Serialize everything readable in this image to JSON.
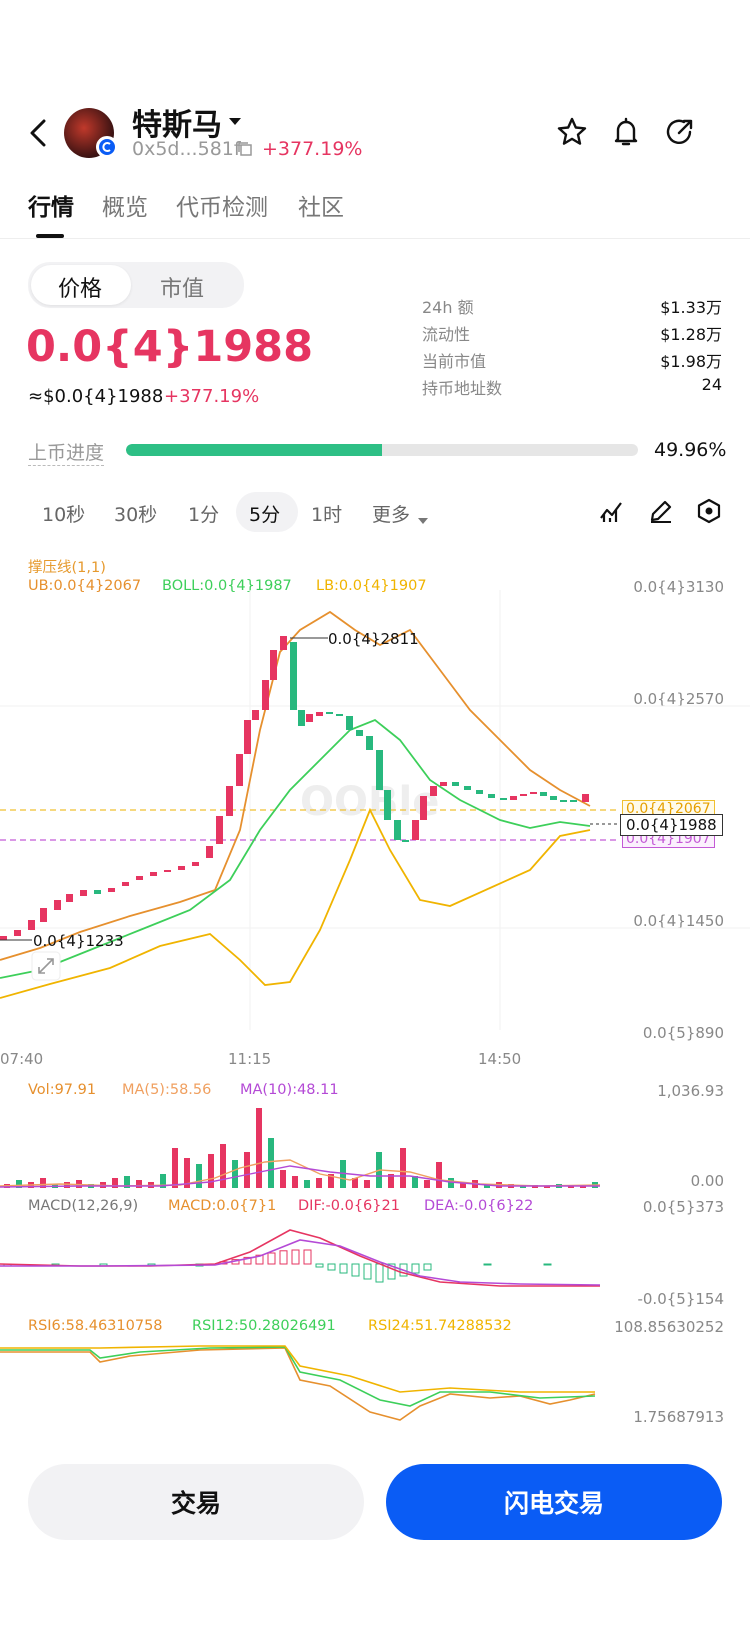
{
  "header": {
    "token_name": "特斯马",
    "address": "0x5d...581f",
    "change": "+377.19%"
  },
  "tabs": [
    "行情",
    "概览",
    "代币检测",
    "社区"
  ],
  "price_toggle": [
    "价格",
    "市值"
  ],
  "price": {
    "main": "0.0{4}1988",
    "usd": "≈$0.0{4}1988",
    "change": "+377.19%"
  },
  "stats": [
    {
      "label": "24h  额",
      "value": "$1.33万"
    },
    {
      "label": "流动性",
      "value": "$1.28万"
    },
    {
      "label": "当前市值",
      "value": "$1.98万"
    },
    {
      "label": "持币地址数",
      "value": "24"
    }
  ],
  "progress": {
    "label": "上币进度",
    "value_text": "49.96%",
    "fraction": 0.4996
  },
  "timeframes": [
    "10秒",
    "30秒",
    "1分",
    "5分",
    "1时",
    "更多"
  ],
  "chart_labels": {
    "indicator_title": "撑压线(1,1)",
    "ub": "UB:0.0{4}2067",
    "boll": "BOLL:0.0{4}1987",
    "lb": "LB:0.0{4}1907",
    "y_axis": [
      "0.0{4}3130",
      "0.0{4}2570",
      "0.0{4}1450",
      "0.0{5}890"
    ],
    "ub_tag": "0.0{4}2067",
    "lb_tag": "0.0{4}1907",
    "current_tag": "0.0{4}1988",
    "high_marker": "0.0{4}2811",
    "low_marker": "0.0{4}1233",
    "x_axis": [
      "07:40",
      "11:15",
      "14:50"
    ]
  },
  "volume": {
    "vol": "Vol:97.91",
    "ma5": "MA(5):58.56",
    "ma10": "MA(10):48.11",
    "max": "1,036.93",
    "min": "0.00"
  },
  "macd": {
    "title": "MACD(12,26,9)",
    "macd": "MACD:0.0{7}1",
    "dif": "DIF:-0.0{6}21",
    "dea": "DEA:-0.0{6}22",
    "max": "0.0{5}373",
    "min": "-0.0{5}154"
  },
  "rsi": {
    "rsi6": "RSI6:58.46310758",
    "rsi12": "RSI12:50.28026491",
    "rsi24": "RSI24:51.74288532",
    "max": "108.85630252",
    "min": "1.75687913"
  },
  "buttons": {
    "trade": "交易",
    "flash": "闪电交易"
  },
  "colors": {
    "up": "#e63561",
    "down": "#28b87e",
    "accent": "#0a5cf5",
    "progress": "#2dbf85"
  }
}
